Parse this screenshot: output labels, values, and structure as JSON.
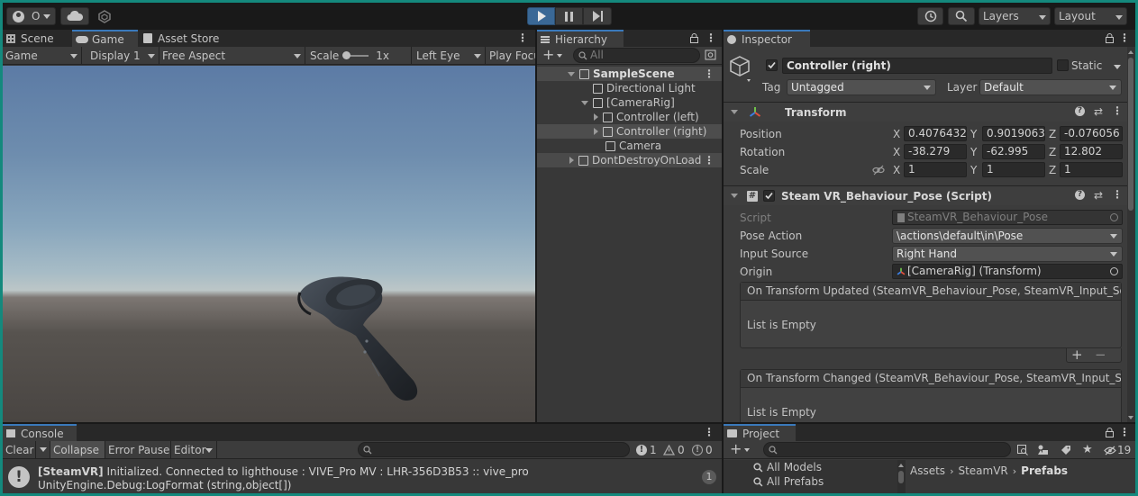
{
  "toolbar": {
    "account_initial": "O",
    "layers_label": "Layers",
    "layout_label": "Layout"
  },
  "scene_panel": {
    "tabs": {
      "scene": "Scene",
      "game": "Game",
      "asset_store": "Asset Store"
    },
    "controls": {
      "display_mode": "Game",
      "display": "Display 1",
      "aspect": "Free Aspect",
      "scale_label": "Scale",
      "scale_value": "1x",
      "eye": "Left Eye",
      "play_focus": "Play Focu"
    }
  },
  "hierarchy": {
    "tab": "Hierarchy",
    "search_placeholder": "All",
    "items": [
      {
        "label": "SampleScene"
      },
      {
        "label": "Directional Light"
      },
      {
        "label": "[CameraRig]"
      },
      {
        "label": "Controller (left)"
      },
      {
        "label": "Controller (right)"
      },
      {
        "label": "Camera"
      },
      {
        "label": "DontDestroyOnLoad"
      }
    ]
  },
  "inspector": {
    "tab": "Inspector",
    "object_name": "Controller (right)",
    "static_label": "Static",
    "tag_label": "Tag",
    "tag_value": "Untagged",
    "layer_label": "Layer",
    "layer_value": "Default",
    "transform": {
      "title": "Transform",
      "position_label": "Position",
      "rotation_label": "Rotation",
      "scale_label": "Scale",
      "axis_x": "X",
      "axis_y": "Y",
      "axis_z": "Z",
      "position": {
        "x": "0.4076432",
        "y": "0.9019063",
        "z": "-0.076056"
      },
      "rotation": {
        "x": "-38.279",
        "y": "-62.995",
        "z": "12.802"
      },
      "scale": {
        "x": "1",
        "y": "1",
        "z": "1"
      }
    },
    "pose_script": {
      "title": "Steam VR_Behaviour_Pose (Script)",
      "script_label": "Script",
      "script_value": "SteamVR_Behaviour_Pose",
      "pose_action_label": "Pose Action",
      "pose_action_value": "\\actions\\default\\in\\Pose",
      "input_source_label": "Input Source",
      "input_source_value": "Right Hand",
      "origin_label": "Origin",
      "origin_value": "[CameraRig] (Transform)",
      "event1_title": "On Transform Updated (SteamVR_Behaviour_Pose, SteamVR_Input_Source",
      "event1_empty": "List is Empty",
      "event2_title": "On Transform Changed (SteamVR_Behaviour_Pose, SteamVR_Input_Sour",
      "event2_empty": "List is Empty",
      "plus": "+",
      "minus": "−"
    }
  },
  "console": {
    "tab": "Console",
    "clear": "Clear",
    "collapse": "Collapse",
    "error_pause": "Error Pause",
    "editor": "Editor",
    "count_info": "1",
    "count_warn": "0",
    "count_error": "0",
    "message_tag": "[SteamVR]",
    "message_line1": " Initialized. Connected to lighthouse : VIVE_Pro MV : LHR-356D3B53 :: vive_pro",
    "message_line2": "UnityEngine.Debug:LogFormat (string,object[])",
    "message_count": "1"
  },
  "project": {
    "tab": "Project",
    "hidden_count": "19",
    "tree": [
      {
        "label": "All Models"
      },
      {
        "label": "All Prefabs"
      }
    ],
    "breadcrumb": {
      "root": "Assets",
      "mid": "SteamVR",
      "current": "Prefabs"
    }
  },
  "colors": {
    "accent_blue": "#3a79bb",
    "frame_teal": "#14897d",
    "sky_top": "#5f7ea8",
    "ground": "#4a4744"
  }
}
